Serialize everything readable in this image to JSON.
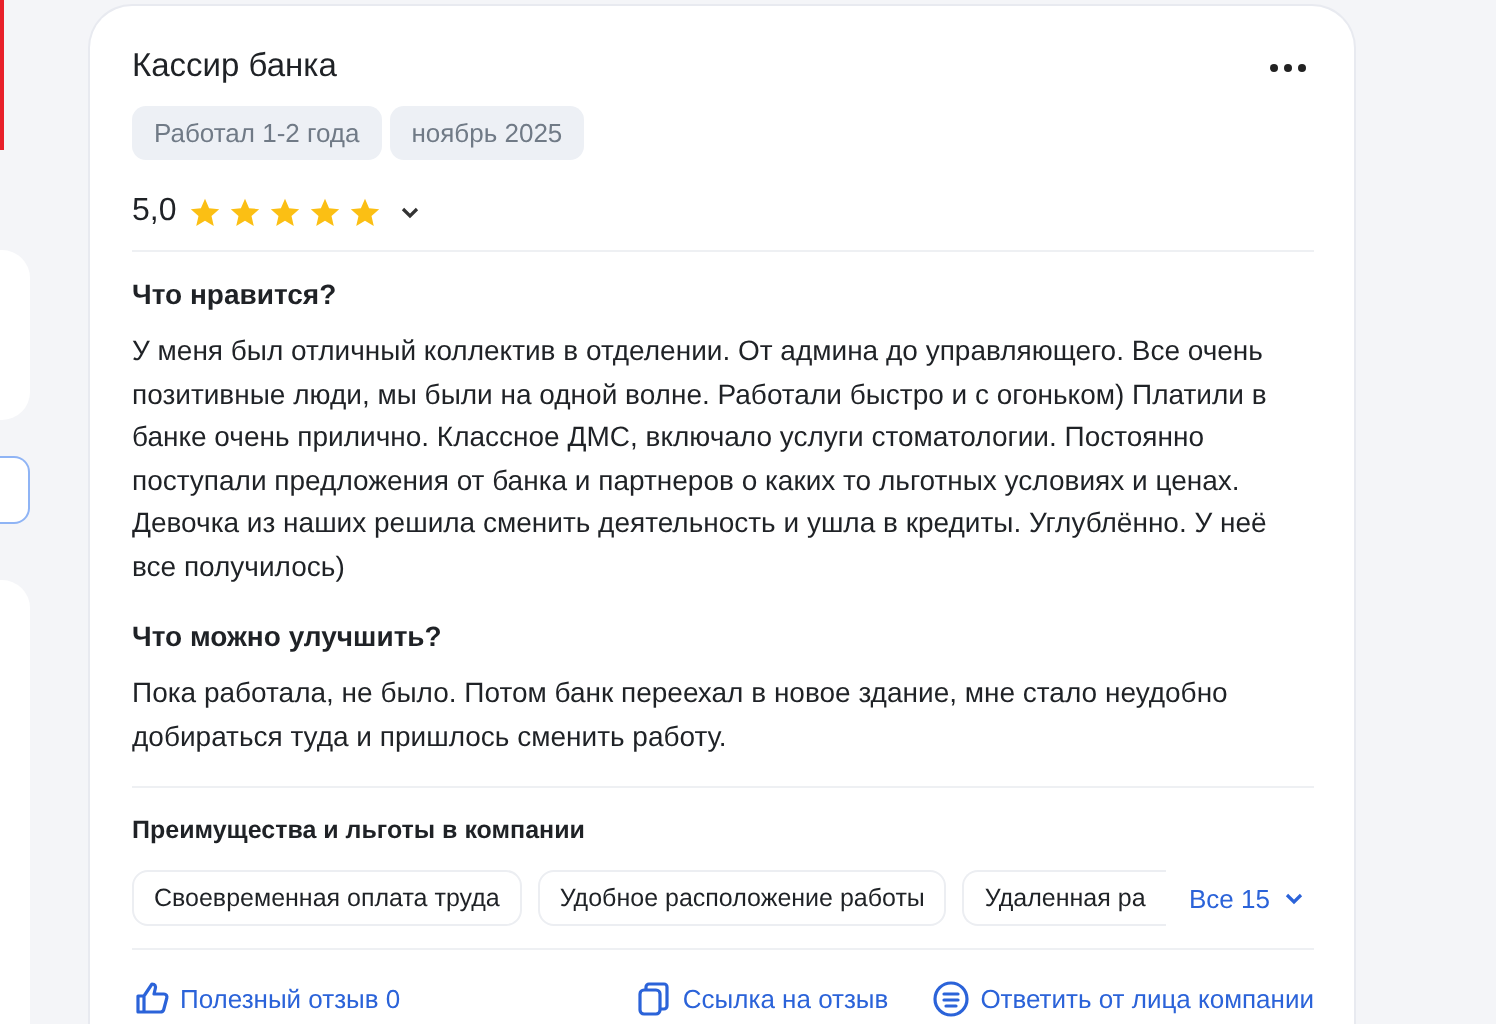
{
  "review": {
    "title": "Кассир банка",
    "tags": [
      "Работал 1-2 года",
      "ноябрь 2025"
    ],
    "rating": "5,0",
    "stars": 5,
    "sections": [
      {
        "heading": "Что нравится?",
        "text": "У меня был отличный коллектив в отделении. От админа до управляющего. Все очень позитивные люди, мы были на одной волне. Работали быстро и с огоньком) Платили в банке очень прилично. Классное ДМС, включало услуги стоматологии. Постоянно поступали предложения от банка и партнеров о каких то льготных условиях и ценах. Девочка из наших решила сменить деятельность и ушла в кредиты. Углублённо. У неё все получилось)"
      },
      {
        "heading": "Что можно улучшить?",
        "text": "Пока работала, не было. Потом банк переехал в новое здание, мне стало неудобно добираться туда и пришлось сменить работу."
      }
    ],
    "benefits": {
      "heading": "Преимущества и льготы в компании",
      "items": [
        "Своевременная оплата труда",
        "Удобное расположение работы",
        "Удаленная ра"
      ],
      "more": "Все 15"
    },
    "actions": [
      {
        "kind": "like",
        "label": "Полезный отзыв 0"
      },
      {
        "kind": "link",
        "label": "Ссылка на отзыв"
      },
      {
        "kind": "reply",
        "label": "Ответить от лица компании"
      }
    ]
  }
}
